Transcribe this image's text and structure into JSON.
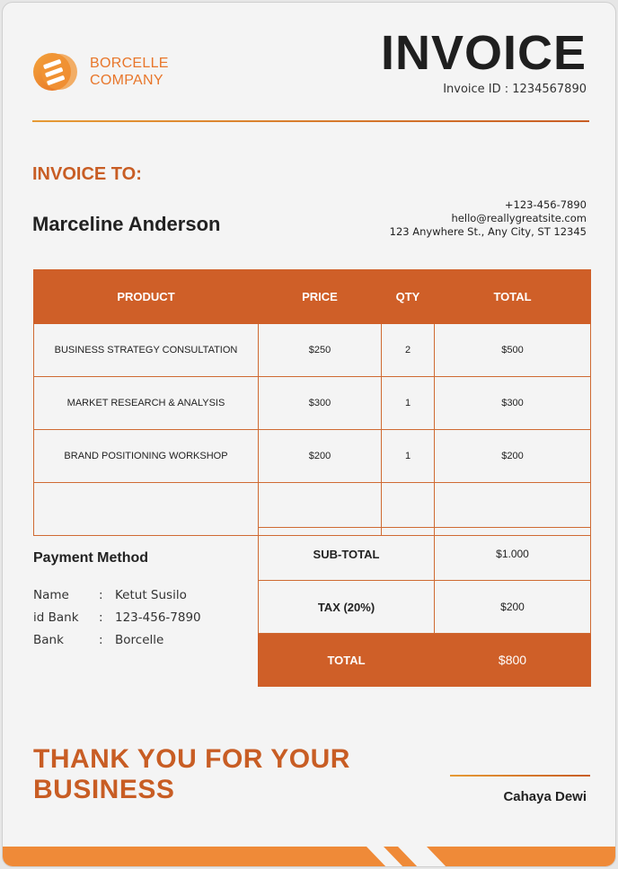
{
  "brand": {
    "line1": "BORCELLE",
    "line2": "COMPANY",
    "logo_icon": "stacked-bars-logo",
    "accent_color": "#cf5f28",
    "orange_color": "#e8762a"
  },
  "header": {
    "title": "INVOICE",
    "invoice_id": "Invoice ID : 1234567890"
  },
  "bill_to": {
    "label": "INVOICE TO:",
    "name": "Marceline Anderson",
    "phone": "+123-456-7890",
    "email": "hello@reallygreatsite.com",
    "address": "123 Anywhere St., Any City, ST 12345"
  },
  "table": {
    "columns": [
      "PRODUCT",
      "PRICE",
      "QTY",
      "TOTAL"
    ],
    "rows": [
      [
        "BUSINESS STRATEGY CONSULTATION",
        "$250",
        "2",
        "$500"
      ],
      [
        "MARKET RESEARCH & ANALYSIS",
        "$300",
        "1",
        "$300"
      ],
      [
        "BRAND POSITIONING WORKSHOP",
        "$200",
        "1",
        "$200"
      ],
      [
        "",
        "",
        "",
        ""
      ]
    ]
  },
  "totals": {
    "subtotal_label": "SUB-TOTAL",
    "subtotal_value": "$1.000",
    "tax_label": "TAX (20%)",
    "tax_value": "$200",
    "total_label": "TOTAL",
    "total_value": "$800"
  },
  "payment": {
    "title": "Payment Method",
    "rows": [
      {
        "key": "Name",
        "sep": ":",
        "value": "Ketut Susilo"
      },
      {
        "key": "id Bank",
        "sep": ":",
        "value": "123-456-7890"
      },
      {
        "key": "Bank",
        "sep": ":",
        "value": "Borcelle"
      }
    ]
  },
  "footer": {
    "thanks_line1": "THANK YOU FOR YOUR",
    "thanks_line2": "BUSINESS",
    "signatory": "Cahaya Dewi"
  }
}
